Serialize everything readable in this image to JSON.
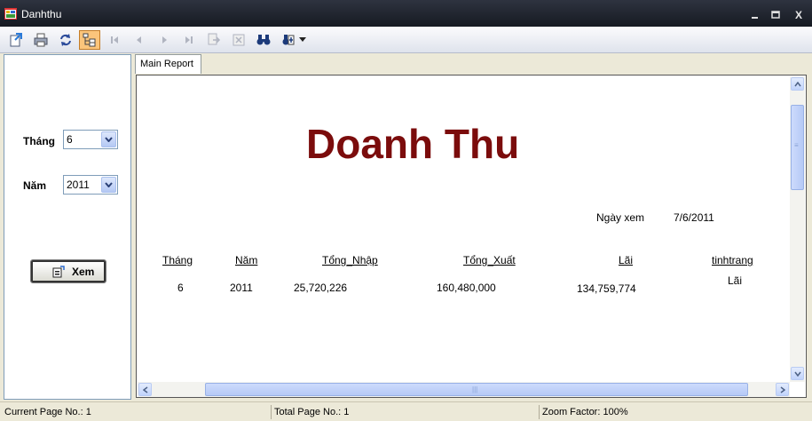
{
  "window": {
    "title": "Danhthu",
    "minimize_label": "_",
    "maximize_label": "□",
    "close_label": "X"
  },
  "toolbar": {
    "icons": [
      "export-icon",
      "print-icon",
      "refresh-icon",
      "group-tree-icon",
      "first-page-icon",
      "prev-page-icon",
      "next-page-icon",
      "last-page-icon",
      "goto-page-icon",
      "close-view-icon",
      "find-icon",
      "zoom-icon"
    ]
  },
  "filter": {
    "month_label": "Tháng",
    "month_value": "6",
    "year_label": "Năm",
    "year_value": "2011",
    "view_button_label": "Xem"
  },
  "report": {
    "tab_label": "Main Report",
    "title": "Doanh Thu",
    "view_date_label": "Ngày xem",
    "view_date_value": "7/6/2011",
    "columns": [
      "Tháng",
      "Năm",
      "Tổng_Nhập",
      "Tổng_Xuất",
      "Lãi",
      "tinhtrang"
    ],
    "rows": [
      [
        "6",
        "2011",
        "25,720,226",
        "160,480,000",
        "134,759,774",
        "Lãi"
      ]
    ]
  },
  "status": {
    "current_page": "Current Page No.: 1",
    "total_page": "Total Page No.: 1",
    "zoom": "Zoom Factor: 100%"
  }
}
